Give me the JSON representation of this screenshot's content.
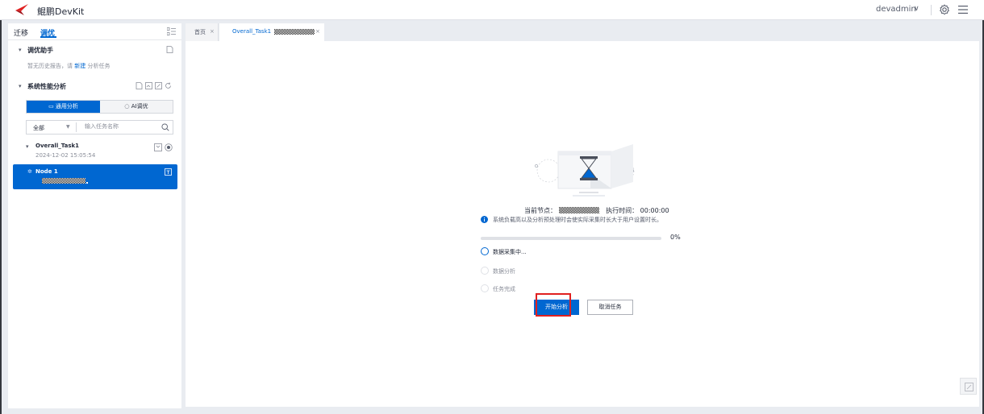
{
  "header": {
    "brand": "鲲鹏DevKit",
    "user": "devadmin",
    "user_caret": "∨"
  },
  "sidebar": {
    "tab_migrate": "迁移",
    "tab_tune": "调优",
    "tuning_assistant": {
      "title": "调优助手",
      "hint_prefix": "暂无历史报告，请",
      "hint_link": "新建",
      "hint_suffix": "分析任务"
    },
    "system_analysis": {
      "title": "系统性能分析",
      "seg_general": "通用分析",
      "seg_ai": "AI调优"
    },
    "filter": {
      "scope": "全部",
      "placeholder": "输入任务名称"
    },
    "task": {
      "name": "Overall_Task1",
      "time": "2024-12-02 15:05:54"
    },
    "node": {
      "name": "Node 1"
    }
  },
  "tabs": [
    {
      "label": "首页",
      "close": "×"
    },
    {
      "label": "Overall_Task1",
      "close": "×"
    }
  ],
  "main": {
    "current_node_label": "当前节点：",
    "exec_time_label": "执行时间：",
    "exec_time_value": "00:00:00",
    "info": "系统负载高以及分析预处理时会使实际采集时长大于用户设置时长。",
    "progress_percent": 0,
    "progress_text": "0%",
    "steps": [
      {
        "label": "数据采集中...",
        "state": "active"
      },
      {
        "label": "数据分析",
        "state": "idle"
      },
      {
        "label": "任务完成",
        "state": "idle"
      }
    ],
    "btn_start": "开始分析",
    "btn_cancel": "取消任务"
  },
  "colors": {
    "accent": "#0067d1",
    "highlight": "#e02020"
  }
}
